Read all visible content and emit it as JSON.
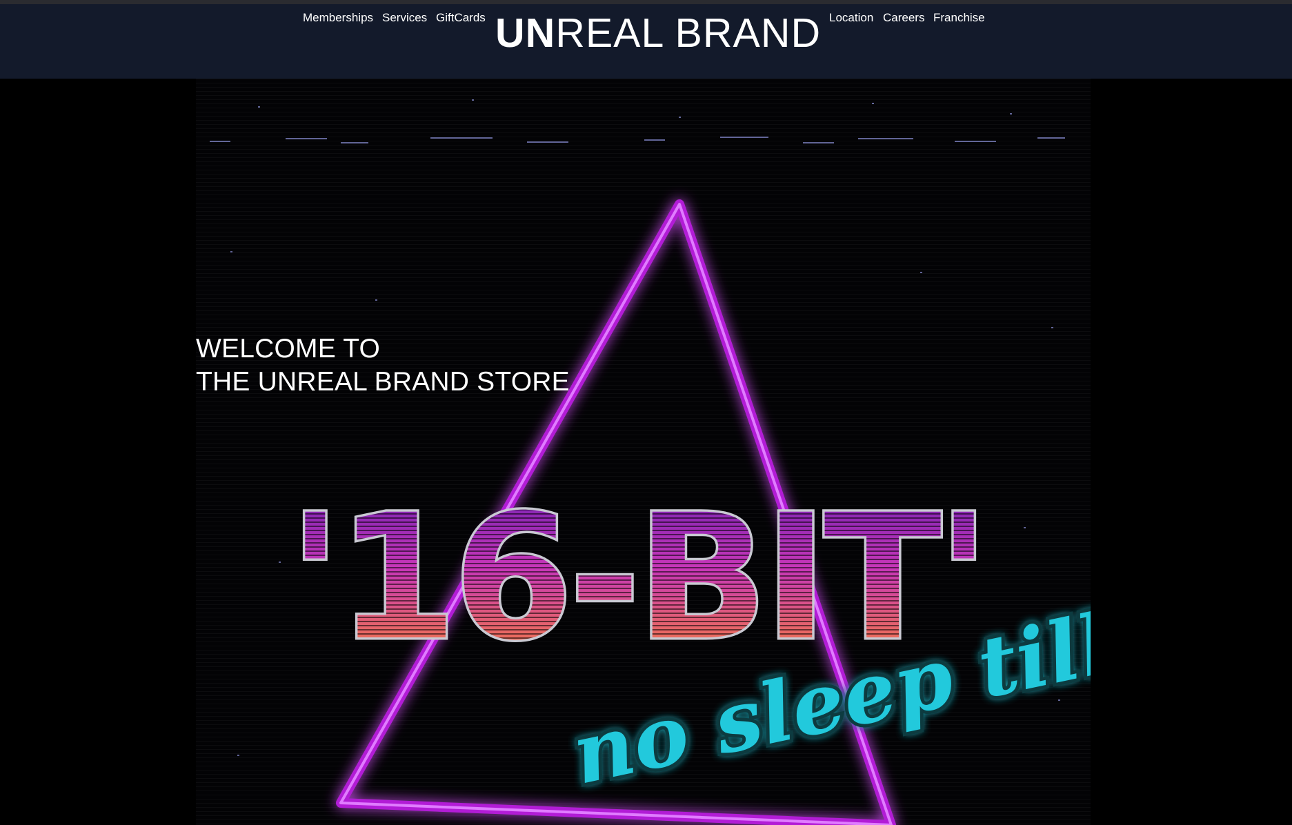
{
  "nav": {
    "left_links": [
      {
        "label": "Memberships"
      },
      {
        "label": "Services"
      },
      {
        "label": "GiftCards"
      }
    ],
    "right_links": [
      {
        "label": "Location"
      },
      {
        "label": "Careers"
      },
      {
        "label": "Franchise"
      }
    ],
    "logo": {
      "bold_part": "UN",
      "thin_part": "REAL BRAND"
    }
  },
  "hero": {
    "headline_line1": "WELCOME TO",
    "headline_line2": "THE UNREAL BRAND STORE",
    "poster_title": "'16-BIT'",
    "poster_tagline": "no sleep till"
  },
  "colors": {
    "navbar_bg": "#131a2b",
    "page_bg": "#000000",
    "neon_purple": "#b21fd6",
    "neon_orange": "#ff8a2a",
    "neon_cyan": "#22c9dc"
  }
}
